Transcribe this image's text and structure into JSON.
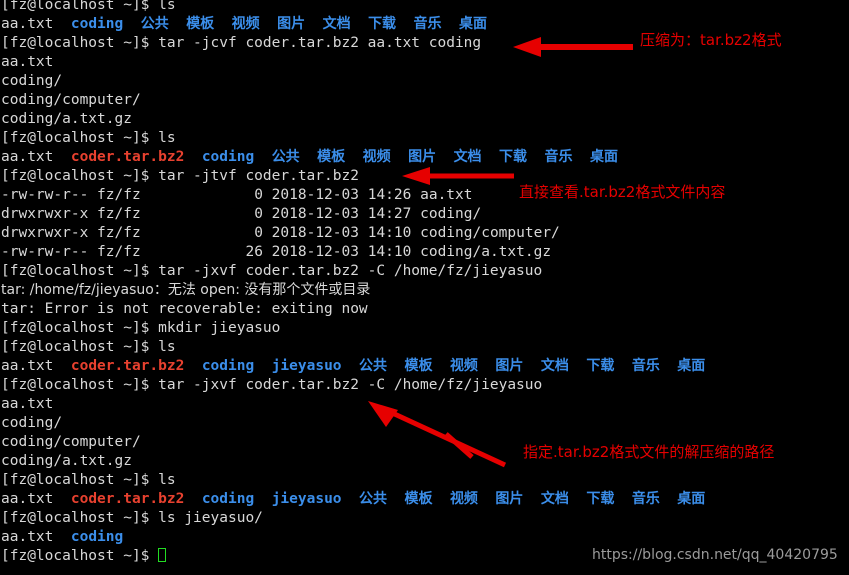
{
  "terminal": {
    "prompt": "[fz@localhost ~]$ ",
    "colors": {
      "background": "#000000",
      "foreground": "#d8d8d8",
      "directory": "#3b8eea",
      "archive": "#e8412f",
      "cursor": "#22dd22",
      "annotation": "#e60000",
      "watermark": "#9b9b9b"
    },
    "commands": {
      "ls": "ls",
      "tar_create": "tar -jcvf coder.tar.bz2 aa.txt coding",
      "tar_list": "tar -jtvf coder.tar.bz2",
      "tar_extract_fail": "tar -jxvf coder.tar.bz2 -C /home/fz/jieyasuo",
      "mkdir": "mkdir jieyasuo",
      "tar_extract_ok": "tar -jxvf coder.tar.bz2 -C /home/fz/jieyasuo",
      "ls_jieyasuo": "ls jieyasuo/"
    },
    "files": {
      "aa": "aa.txt",
      "archive": "coder.tar.bz2",
      "coding": "coding",
      "jieyasuo": "jieyasuo",
      "coding_slash": "coding/",
      "coding_computer": "coding/computer/",
      "coding_atxtgz": "coding/a.txt.gz"
    },
    "dirs_cjk": {
      "gonggong": "公共",
      "muban": "模板",
      "shipin": "视频",
      "tupian": "图片",
      "wendang": "文档",
      "xiazai": "下载",
      "yinyue": "音乐",
      "zhuomian": "桌面"
    },
    "tar_listing": [
      {
        "perms": "-rw-rw-r--",
        "owner": "fz/fz",
        "size": "0",
        "date": "2018-12-03",
        "time": "14:26",
        "name": "aa.txt"
      },
      {
        "perms": "drwxrwxr-x",
        "owner": "fz/fz",
        "size": "0",
        "date": "2018-12-03",
        "time": "14:27",
        "name": "coding/"
      },
      {
        "perms": "drwxrwxr-x",
        "owner": "fz/fz",
        "size": "0",
        "date": "2018-12-03",
        "time": "14:10",
        "name": "coding/computer/"
      },
      {
        "perms": "-rw-rw-r--",
        "owner": "fz/fz",
        "size": "26",
        "date": "2018-12-03",
        "time": "14:10",
        "name": "coding/a.txt.gz"
      }
    ],
    "errors": {
      "open_fail": "tar: /home/fz/jieyasuo：无法 open: 没有那个文件或目录",
      "not_recoverable": "tar: Error is not recoverable: exiting now"
    }
  },
  "annotations": {
    "compress": "压缩为：tar.bz2格式",
    "view": "直接查看.tar.bz2格式文件内容",
    "path": "指定.tar.bz2格式文件的解压缩的路径"
  },
  "watermark": {
    "url": "https://blog.csdn.net/qq_40420795"
  }
}
